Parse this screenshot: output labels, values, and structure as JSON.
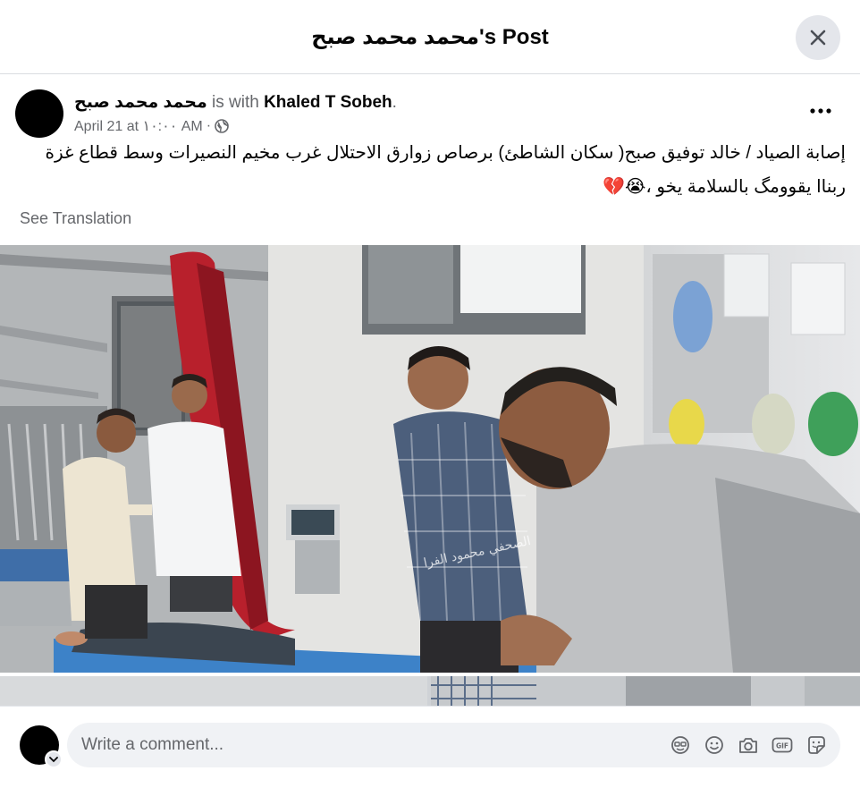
{
  "header": {
    "title": "محمد محمد صبح's Post"
  },
  "post": {
    "author": "محمد محمد صبح",
    "with_text": " is with ",
    "tagged": "Khaled T Sobeh",
    "tagged_suffix": ".",
    "timestamp": "April 21 at ١٠:٠٠ AM",
    "privacy_sep": " · ",
    "privacy_icon": "globe-icon",
    "text_line1": "إصابة الصياد / خالد توفيق صبح( سكان الشاطئ)  برصاص زوارق الاحتلال غرب مخيم النصيرات وسط قطاع غزة",
    "text_line2": "ربناا يقوومگ بالسلامة يخو ،😭💔",
    "see_translation": "See Translation",
    "photo_watermark": "الصحفي محمود الفرا"
  },
  "composer": {
    "placeholder": "Write a comment...",
    "icons": [
      "avatar-sticker-icon",
      "emoji-icon",
      "camera-icon",
      "gif-icon",
      "sticker-icon"
    ]
  },
  "colors": {
    "muted": "#65676b",
    "text": "#050505",
    "divider": "#dadde1",
    "button_bg": "#e4e6eb",
    "input_bg": "#f0f2f5"
  }
}
